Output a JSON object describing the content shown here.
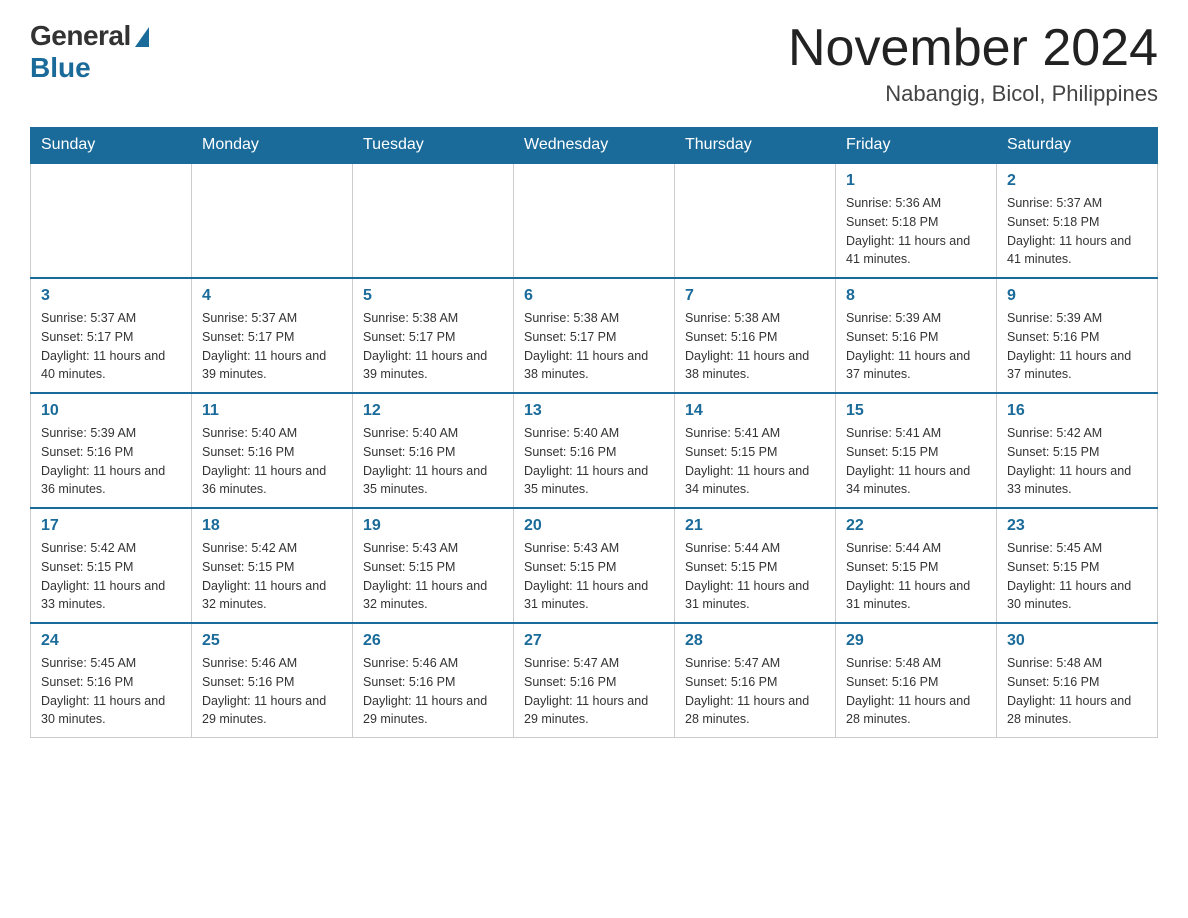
{
  "header": {
    "logo_general": "General",
    "logo_blue": "Blue",
    "title": "November 2024",
    "subtitle": "Nabangig, Bicol, Philippines"
  },
  "days_of_week": [
    "Sunday",
    "Monday",
    "Tuesday",
    "Wednesday",
    "Thursday",
    "Friday",
    "Saturday"
  ],
  "weeks": [
    [
      {
        "day": "",
        "info": ""
      },
      {
        "day": "",
        "info": ""
      },
      {
        "day": "",
        "info": ""
      },
      {
        "day": "",
        "info": ""
      },
      {
        "day": "",
        "info": ""
      },
      {
        "day": "1",
        "info": "Sunrise: 5:36 AM\nSunset: 5:18 PM\nDaylight: 11 hours and 41 minutes."
      },
      {
        "day": "2",
        "info": "Sunrise: 5:37 AM\nSunset: 5:18 PM\nDaylight: 11 hours and 41 minutes."
      }
    ],
    [
      {
        "day": "3",
        "info": "Sunrise: 5:37 AM\nSunset: 5:17 PM\nDaylight: 11 hours and 40 minutes."
      },
      {
        "day": "4",
        "info": "Sunrise: 5:37 AM\nSunset: 5:17 PM\nDaylight: 11 hours and 39 minutes."
      },
      {
        "day": "5",
        "info": "Sunrise: 5:38 AM\nSunset: 5:17 PM\nDaylight: 11 hours and 39 minutes."
      },
      {
        "day": "6",
        "info": "Sunrise: 5:38 AM\nSunset: 5:17 PM\nDaylight: 11 hours and 38 minutes."
      },
      {
        "day": "7",
        "info": "Sunrise: 5:38 AM\nSunset: 5:16 PM\nDaylight: 11 hours and 38 minutes."
      },
      {
        "day": "8",
        "info": "Sunrise: 5:39 AM\nSunset: 5:16 PM\nDaylight: 11 hours and 37 minutes."
      },
      {
        "day": "9",
        "info": "Sunrise: 5:39 AM\nSunset: 5:16 PM\nDaylight: 11 hours and 37 minutes."
      }
    ],
    [
      {
        "day": "10",
        "info": "Sunrise: 5:39 AM\nSunset: 5:16 PM\nDaylight: 11 hours and 36 minutes."
      },
      {
        "day": "11",
        "info": "Sunrise: 5:40 AM\nSunset: 5:16 PM\nDaylight: 11 hours and 36 minutes."
      },
      {
        "day": "12",
        "info": "Sunrise: 5:40 AM\nSunset: 5:16 PM\nDaylight: 11 hours and 35 minutes."
      },
      {
        "day": "13",
        "info": "Sunrise: 5:40 AM\nSunset: 5:16 PM\nDaylight: 11 hours and 35 minutes."
      },
      {
        "day": "14",
        "info": "Sunrise: 5:41 AM\nSunset: 5:15 PM\nDaylight: 11 hours and 34 minutes."
      },
      {
        "day": "15",
        "info": "Sunrise: 5:41 AM\nSunset: 5:15 PM\nDaylight: 11 hours and 34 minutes."
      },
      {
        "day": "16",
        "info": "Sunrise: 5:42 AM\nSunset: 5:15 PM\nDaylight: 11 hours and 33 minutes."
      }
    ],
    [
      {
        "day": "17",
        "info": "Sunrise: 5:42 AM\nSunset: 5:15 PM\nDaylight: 11 hours and 33 minutes."
      },
      {
        "day": "18",
        "info": "Sunrise: 5:42 AM\nSunset: 5:15 PM\nDaylight: 11 hours and 32 minutes."
      },
      {
        "day": "19",
        "info": "Sunrise: 5:43 AM\nSunset: 5:15 PM\nDaylight: 11 hours and 32 minutes."
      },
      {
        "day": "20",
        "info": "Sunrise: 5:43 AM\nSunset: 5:15 PM\nDaylight: 11 hours and 31 minutes."
      },
      {
        "day": "21",
        "info": "Sunrise: 5:44 AM\nSunset: 5:15 PM\nDaylight: 11 hours and 31 minutes."
      },
      {
        "day": "22",
        "info": "Sunrise: 5:44 AM\nSunset: 5:15 PM\nDaylight: 11 hours and 31 minutes."
      },
      {
        "day": "23",
        "info": "Sunrise: 5:45 AM\nSunset: 5:15 PM\nDaylight: 11 hours and 30 minutes."
      }
    ],
    [
      {
        "day": "24",
        "info": "Sunrise: 5:45 AM\nSunset: 5:16 PM\nDaylight: 11 hours and 30 minutes."
      },
      {
        "day": "25",
        "info": "Sunrise: 5:46 AM\nSunset: 5:16 PM\nDaylight: 11 hours and 29 minutes."
      },
      {
        "day": "26",
        "info": "Sunrise: 5:46 AM\nSunset: 5:16 PM\nDaylight: 11 hours and 29 minutes."
      },
      {
        "day": "27",
        "info": "Sunrise: 5:47 AM\nSunset: 5:16 PM\nDaylight: 11 hours and 29 minutes."
      },
      {
        "day": "28",
        "info": "Sunrise: 5:47 AM\nSunset: 5:16 PM\nDaylight: 11 hours and 28 minutes."
      },
      {
        "day": "29",
        "info": "Sunrise: 5:48 AM\nSunset: 5:16 PM\nDaylight: 11 hours and 28 minutes."
      },
      {
        "day": "30",
        "info": "Sunrise: 5:48 AM\nSunset: 5:16 PM\nDaylight: 11 hours and 28 minutes."
      }
    ]
  ]
}
